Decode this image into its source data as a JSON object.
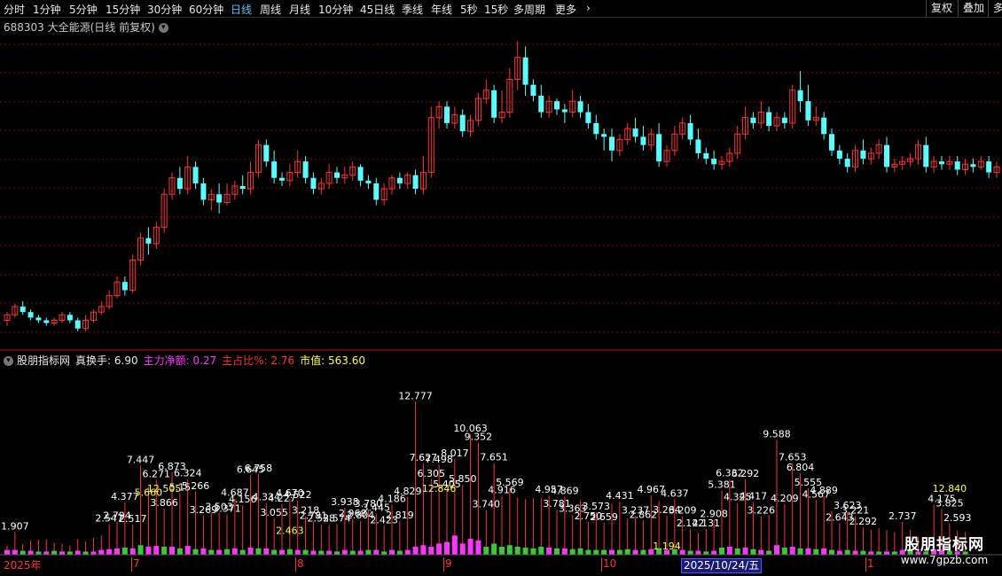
{
  "toolbar": {
    "timeframes": [
      "分时",
      "1分钟",
      "5分钟",
      "15分钟",
      "30分钟",
      "60分钟",
      "日线",
      "周线",
      "月线",
      "10分钟",
      "45日线",
      "季线",
      "年线",
      "5秒",
      "15秒",
      "多周期",
      "更多"
    ],
    "active_timeframe": "日线",
    "right_buttons": [
      "复权",
      "叠加",
      "多"
    ]
  },
  "stock": {
    "title": "688303 大全能源(日线 前复权)"
  },
  "indicator": {
    "name": "股朋指标网",
    "items": [
      {
        "label": "真换手: 6.90",
        "color": "#e8e8e8"
      },
      {
        "label": "主力净额: 0.27",
        "color": "#ff33ff"
      },
      {
        "label": "主占比%: 2.76",
        "color": "#ff3333"
      },
      {
        "label": "市值: 563.60",
        "color": "#ffff33"
      }
    ]
  },
  "axis": {
    "month_labels": [
      "2025年",
      "7",
      "8",
      "9",
      "10",
      "1"
    ],
    "cursor_date": "2025/10/24/五"
  },
  "watermark": {
    "title": "股朋指标网",
    "url": "www.7gpzb.com"
  },
  "colors": {
    "up": "#ff3333",
    "down": "#54ffff",
    "white_label": "#ffffff",
    "yellow_label": "#ffff33",
    "pos_bar": "#ff33ff",
    "neg_bar": "#33cc33",
    "stem": "#ff3333",
    "grid": "#8a0000"
  },
  "candles": [
    [
      46,
      48,
      44,
      49
    ],
    [
      48,
      51,
      47,
      52
    ],
    [
      51,
      49,
      48,
      53
    ],
    [
      49,
      47,
      46,
      50
    ],
    [
      47,
      46,
      45,
      48
    ],
    [
      46,
      45,
      44,
      47
    ],
    [
      45,
      46,
      44,
      47
    ],
    [
      46,
      48,
      45,
      49
    ],
    [
      48,
      46,
      45,
      49
    ],
    [
      46,
      43,
      42,
      47
    ],
    [
      43,
      46,
      42,
      48
    ],
    [
      46,
      49,
      45,
      50
    ],
    [
      49,
      51,
      48,
      53
    ],
    [
      51,
      55,
      50,
      57
    ],
    [
      55,
      60,
      54,
      62
    ],
    [
      60,
      57,
      55,
      62
    ],
    [
      57,
      68,
      56,
      70
    ],
    [
      68,
      76,
      66,
      78
    ],
    [
      76,
      74,
      70,
      80
    ],
    [
      74,
      80,
      72,
      82
    ],
    [
      80,
      92,
      78,
      94
    ],
    [
      92,
      98,
      90,
      100
    ],
    [
      98,
      94,
      92,
      102
    ],
    [
      94,
      102,
      92,
      106
    ],
    [
      102,
      96,
      94,
      104
    ],
    [
      96,
      90,
      88,
      98
    ],
    [
      90,
      92,
      86,
      94
    ],
    [
      92,
      89,
      85,
      96
    ],
    [
      89,
      92,
      88,
      96
    ],
    [
      92,
      95,
      90,
      97
    ],
    [
      95,
      94,
      92,
      99
    ],
    [
      94,
      100,
      92,
      104
    ],
    [
      100,
      110,
      98,
      112
    ],
    [
      110,
      104,
      102,
      112
    ],
    [
      104,
      98,
      96,
      108
    ],
    [
      98,
      97,
      95,
      100
    ],
    [
      97,
      100,
      95,
      103
    ],
    [
      100,
      104,
      98,
      108
    ],
    [
      104,
      98,
      96,
      106
    ],
    [
      98,
      94,
      92,
      100
    ],
    [
      94,
      96,
      92,
      98
    ],
    [
      96,
      100,
      94,
      103
    ],
    [
      100,
      98,
      96,
      102
    ],
    [
      98,
      99,
      96,
      102
    ],
    [
      99,
      102,
      97,
      104
    ],
    [
      102,
      97,
      95,
      103
    ],
    [
      97,
      96,
      94,
      99
    ],
    [
      96,
      90,
      88,
      98
    ],
    [
      90,
      94,
      88,
      96
    ],
    [
      94,
      98,
      92,
      99
    ],
    [
      98,
      96,
      94,
      100
    ],
    [
      96,
      99,
      94,
      100
    ],
    [
      99,
      94,
      92,
      101
    ],
    [
      94,
      100,
      92,
      106
    ],
    [
      100,
      120,
      98,
      124
    ],
    [
      120,
      124,
      116,
      126
    ],
    [
      124,
      118,
      116,
      126
    ],
    [
      118,
      121,
      116,
      124
    ],
    [
      121,
      115,
      113,
      123
    ],
    [
      115,
      119,
      113,
      121
    ],
    [
      119,
      127,
      117,
      129
    ],
    [
      127,
      130,
      125,
      134
    ],
    [
      130,
      120,
      118,
      132
    ],
    [
      120,
      122,
      118,
      130
    ],
    [
      122,
      134,
      120,
      138
    ],
    [
      134,
      142,
      130,
      148
    ],
    [
      142,
      132,
      128,
      146
    ],
    [
      132,
      128,
      126,
      134
    ],
    [
      128,
      122,
      120,
      132
    ],
    [
      122,
      126,
      120,
      128
    ],
    [
      126,
      123,
      121,
      127
    ],
    [
      123,
      122,
      118,
      125
    ],
    [
      122,
      126,
      120,
      130
    ],
    [
      126,
      122,
      120,
      128
    ],
    [
      122,
      118,
      116,
      125
    ],
    [
      118,
      114,
      112,
      121
    ],
    [
      114,
      113,
      108,
      116
    ],
    [
      113,
      108,
      104,
      116
    ],
    [
      108,
      112,
      106,
      114
    ],
    [
      112,
      116,
      110,
      118
    ],
    [
      116,
      113,
      111,
      120
    ],
    [
      113,
      110,
      108,
      117
    ],
    [
      110,
      114,
      108,
      116
    ],
    [
      114,
      104,
      102,
      118
    ],
    [
      104,
      108,
      102,
      110
    ],
    [
      108,
      114,
      106,
      117
    ],
    [
      114,
      118,
      112,
      120
    ],
    [
      118,
      112,
      110,
      121
    ],
    [
      112,
      107,
      105,
      116
    ],
    [
      107,
      105,
      103,
      109
    ],
    [
      105,
      103,
      101,
      108
    ],
    [
      103,
      104,
      101,
      106
    ],
    [
      104,
      107,
      102,
      109
    ],
    [
      107,
      114,
      105,
      117
    ],
    [
      114,
      120,
      112,
      124
    ],
    [
      120,
      118,
      116,
      122
    ],
    [
      118,
      122,
      116,
      126
    ],
    [
      122,
      117,
      115,
      124
    ],
    [
      117,
      120,
      115,
      122
    ],
    [
      120,
      118,
      116,
      122
    ],
    [
      118,
      130,
      116,
      132
    ],
    [
      130,
      126,
      122,
      137
    ],
    [
      126,
      119,
      117,
      132
    ],
    [
      119,
      120,
      117,
      124
    ],
    [
      120,
      114,
      112,
      122
    ],
    [
      114,
      108,
      106,
      116
    ],
    [
      108,
      105,
      103,
      110
    ],
    [
      105,
      102,
      100,
      107
    ],
    [
      102,
      108,
      100,
      110
    ],
    [
      108,
      105,
      103,
      112
    ],
    [
      105,
      107,
      103,
      109
    ],
    [
      107,
      110,
      105,
      112
    ],
    [
      110,
      102,
      100,
      113
    ],
    [
      102,
      103,
      100,
      105
    ],
    [
      103,
      104,
      101,
      106
    ],
    [
      104,
      105,
      102,
      107
    ],
    [
      105,
      110,
      103,
      112
    ],
    [
      110,
      102,
      100,
      113
    ],
    [
      102,
      104,
      100,
      106
    ],
    [
      104,
      103,
      101,
      106
    ],
    [
      103,
      104,
      101,
      106
    ],
    [
      104,
      101,
      99,
      106
    ],
    [
      101,
      103,
      99,
      105
    ],
    [
      103,
      102,
      100,
      105
    ],
    [
      102,
      104,
      101,
      106
    ],
    [
      104,
      100,
      98,
      106
    ],
    [
      100,
      102,
      98,
      104
    ]
  ],
  "volume_bars": [
    [
      0.8,
      0.3
    ],
    [
      1.907,
      0.3
    ],
    [
      0.9,
      -0.25
    ],
    [
      1.2,
      0.25
    ],
    [
      1.25,
      -0.2
    ],
    [
      1.247,
      0.2
    ],
    [
      1.0,
      -0.25
    ],
    [
      0.9,
      0.2
    ],
    [
      0.8,
      -0.2
    ],
    [
      1.3,
      0.25
    ],
    [
      1.1,
      -0.2
    ],
    [
      1.4,
      0.2
    ],
    [
      1.65,
      0.3
    ],
    [
      2.547,
      0.35
    ],
    [
      2.794,
      0.4
    ],
    [
      4.377,
      -0.45
    ],
    [
      2.517,
      0.4
    ],
    [
      7.447,
      -0.6
    ],
    [
      5.66,
      0.5
    ],
    [
      6.271,
      0.55
    ],
    [
      3.866,
      -0.5
    ],
    [
      6.873,
      0.5
    ],
    [
      5.15,
      -0.4
    ],
    [
      6.324,
      0.55
    ],
    [
      5.266,
      -0.35
    ],
    [
      3.269,
      0.4
    ],
    [
      3.511,
      -0.3
    ],
    [
      3.503,
      0.3
    ],
    [
      3.371,
      -0.35
    ],
    [
      4.687,
      0.4
    ],
    [
      4.156,
      -0.3
    ],
    [
      6.645,
      0.45
    ],
    [
      6.758,
      -0.4
    ],
    [
      4.334,
      0.4
    ],
    [
      3.055,
      -0.3
    ],
    [
      4.227,
      0.3
    ],
    [
      4.67,
      -0.35
    ],
    [
      4.522,
      0.3
    ],
    [
      3.218,
      -0.3
    ],
    [
      2.781,
      0.25
    ],
    [
      2.538,
      -0.25
    ],
    [
      2.454,
      0.25
    ],
    [
      2.574,
      -0.2
    ],
    [
      3.938,
      0.3
    ],
    [
      2.968,
      -0.25
    ],
    [
      2.804,
      0.25
    ],
    [
      3.78,
      -0.3
    ],
    [
      3.445,
      0.3
    ],
    [
      2.423,
      -0.2
    ],
    [
      4.186,
      0.3
    ],
    [
      2.819,
      -0.25
    ],
    [
      4.829,
      0.3
    ],
    [
      12.777,
      0.5
    ],
    [
      7.627,
      0.6
    ],
    [
      6.305,
      0.5
    ],
    [
      7.498,
      0.7
    ],
    [
      5.405,
      0.8
    ],
    [
      8.017,
      1.2
    ],
    [
      5.85,
      0.7
    ],
    [
      10.063,
      1.0
    ],
    [
      9.352,
      0.9
    ],
    [
      3.74,
      -0.5
    ],
    [
      7.651,
      -0.7
    ],
    [
      4.916,
      -0.5
    ],
    [
      5.569,
      -0.6
    ],
    [
      4.78,
      -0.5
    ],
    [
      4.649,
      -0.45
    ],
    [
      4.752,
      -0.4
    ],
    [
      4.781,
      -0.5
    ],
    [
      4.957,
      0.45
    ],
    [
      3.781,
      -0.4
    ],
    [
      4.869,
      0.4
    ],
    [
      3.363,
      -0.35
    ],
    [
      4.564,
      -0.4
    ],
    [
      2.75,
      -0.3
    ],
    [
      3.573,
      -0.3
    ],
    [
      2.659,
      -0.3
    ],
    [
      4.264,
      0.3
    ],
    [
      4.431,
      -0.3
    ],
    [
      3.033,
      -0.35
    ],
    [
      3.237,
      0.3
    ],
    [
      2.862,
      -0.3
    ],
    [
      4.967,
      0.35
    ],
    [
      4.498,
      -0.4
    ],
    [
      3.264,
      0.3
    ],
    [
      4.637,
      -0.35
    ],
    [
      3.209,
      0.3
    ],
    [
      2.142,
      -0.25
    ],
    [
      1.831,
      0.25
    ],
    [
      2.131,
      -0.2
    ],
    [
      2.908,
      0.25
    ],
    [
      5.381,
      -0.45
    ],
    [
      6.332,
      0.5
    ],
    [
      4.325,
      -0.4
    ],
    [
      6.292,
      0.45
    ],
    [
      4.417,
      -0.35
    ],
    [
      3.226,
      0.3
    ],
    [
      3.306,
      -0.25
    ],
    [
      9.588,
      0.6
    ],
    [
      4.209,
      -0.45
    ],
    [
      7.653,
      0.5
    ],
    [
      6.804,
      -0.4
    ],
    [
      5.555,
      0.4
    ],
    [
      4.567,
      -0.35
    ],
    [
      4.889,
      0.4
    ],
    [
      3.63,
      -0.3
    ],
    [
      2.643,
      0.25
    ],
    [
      3.623,
      -0.3
    ],
    [
      3.221,
      0.25
    ],
    [
      2.292,
      -0.25
    ],
    [
      2.083,
      0.2
    ],
    [
      2.222,
      -0.2
    ],
    [
      2.063,
      0.2
    ],
    [
      1.9,
      -0.2
    ],
    [
      2.737,
      0.3
    ],
    [
      2.067,
      -0.25
    ],
    [
      1.5,
      0.2
    ],
    [
      1.3,
      -0.2
    ],
    [
      4.175,
      0.35
    ],
    [
      3.825,
      0.3
    ],
    [
      2.593,
      -0.25
    ],
    [
      2.013,
      0.2
    ],
    [
      1.9,
      -0.2
    ]
  ],
  "volume_labels": [
    {
      "i": 1,
      "t": "1.907",
      "c": "w"
    },
    {
      "i": 13,
      "t": "2.547",
      "c": "w"
    },
    {
      "i": 14,
      "t": "2.794",
      "c": "w"
    },
    {
      "i": 15,
      "t": "4.377",
      "c": "w"
    },
    {
      "i": 16,
      "t": "2.517",
      "c": "w"
    },
    {
      "i": 17,
      "t": "7.447",
      "c": "w"
    },
    {
      "i": 18,
      "t": "5.660",
      "c": "y"
    },
    {
      "i": 19,
      "t": "6.271",
      "c": "w"
    },
    {
      "i": 20,
      "t": "3.866",
      "c": "w"
    },
    {
      "i": 21,
      "t": "6.873",
      "c": "w"
    },
    {
      "i": 22,
      "t": "5.15",
      "c": "w"
    },
    {
      "i": 23,
      "t": "6.324",
      "c": "w"
    },
    {
      "i": 24,
      "t": "5.266",
      "c": "w"
    },
    {
      "i": 25,
      "t": "3.269",
      "c": "w"
    },
    {
      "i": 27,
      "t": "3.503",
      "c": "w"
    },
    {
      "i": 28,
      "t": "3.371",
      "c": "w"
    },
    {
      "i": 29,
      "t": "4.687",
      "c": "w"
    },
    {
      "i": 30,
      "t": "4.156",
      "c": "w"
    },
    {
      "i": 31,
      "t": "6.645",
      "c": "w"
    },
    {
      "i": 32,
      "t": "6.758",
      "c": "w"
    },
    {
      "i": 33,
      "t": "4.334",
      "c": "w"
    },
    {
      "i": 34,
      "t": "3.055",
      "c": "w"
    },
    {
      "i": 35,
      "t": "4.227",
      "c": "w"
    },
    {
      "i": 36,
      "t": "4.670",
      "c": "w"
    },
    {
      "i": 37,
      "t": "4.522",
      "c": "w"
    },
    {
      "i": 38,
      "t": "3.218",
      "c": "w"
    },
    {
      "i": 39,
      "t": "2.781",
      "c": "w"
    },
    {
      "i": 40,
      "t": "2.538",
      "c": "w"
    },
    {
      "i": 42,
      "t": "2.574",
      "c": "w"
    },
    {
      "i": 43,
      "t": "3.938",
      "c": "w"
    },
    {
      "i": 44,
      "t": "2.968",
      "c": "w"
    },
    {
      "i": 45,
      "t": "2.804",
      "c": "w"
    },
    {
      "i": 46,
      "t": "3.780",
      "c": "w"
    },
    {
      "i": 47,
      "t": "3.445",
      "c": "w"
    },
    {
      "i": 48,
      "t": "2.423",
      "c": "w"
    },
    {
      "i": 49,
      "t": "4.186",
      "c": "w"
    },
    {
      "i": 50,
      "t": "2.819",
      "c": "w"
    },
    {
      "i": 51,
      "t": "4.829",
      "c": "w"
    },
    {
      "i": 52,
      "t": "12.777",
      "c": "w"
    },
    {
      "i": 53,
      "t": "7.627",
      "c": "w"
    },
    {
      "i": 54,
      "t": "6.305",
      "c": "w"
    },
    {
      "i": 55,
      "t": "7.498",
      "c": "w"
    },
    {
      "i": 56,
      "t": "5.405",
      "c": "w"
    },
    {
      "i": 57,
      "t": "8.017",
      "c": "w"
    },
    {
      "i": 58,
      "t": "5.850",
      "c": "w"
    },
    {
      "i": 59,
      "t": "10.063",
      "c": "w"
    },
    {
      "i": 60,
      "t": "9.352",
      "c": "w"
    },
    {
      "i": 61,
      "t": "3.740",
      "c": "w"
    },
    {
      "i": 62,
      "t": "7.651",
      "c": "w"
    },
    {
      "i": 63,
      "t": "4.916",
      "c": "w"
    },
    {
      "i": 64,
      "t": "5.569",
      "c": "w"
    },
    {
      "i": 69,
      "t": "4.957",
      "c": "w"
    },
    {
      "i": 70,
      "t": "3.781",
      "c": "w"
    },
    {
      "i": 71,
      "t": "4.869",
      "c": "w"
    },
    {
      "i": 72,
      "t": "3.363",
      "c": "w"
    },
    {
      "i": 74,
      "t": "2.750",
      "c": "w"
    },
    {
      "i": 75,
      "t": "3.573",
      "c": "w"
    },
    {
      "i": 76,
      "t": "2.659",
      "c": "w"
    },
    {
      "i": 78,
      "t": "4.431",
      "c": "w"
    },
    {
      "i": 80,
      "t": "3.237",
      "c": "w"
    },
    {
      "i": 81,
      "t": "2.862",
      "c": "w"
    },
    {
      "i": 82,
      "t": "4.967",
      "c": "w"
    },
    {
      "i": 84,
      "t": "3.264",
      "c": "w"
    },
    {
      "i": 85,
      "t": "4.637",
      "c": "w"
    },
    {
      "i": 86,
      "t": "3.209",
      "c": "w"
    },
    {
      "i": 87,
      "t": "2.142",
      "c": "w"
    },
    {
      "i": 89,
      "t": "2.131",
      "c": "w"
    },
    {
      "i": 90,
      "t": "2.908",
      "c": "w"
    },
    {
      "i": 91,
      "t": "5.381",
      "c": "w"
    },
    {
      "i": 92,
      "t": "6.332",
      "c": "w"
    },
    {
      "i": 93,
      "t": "4.325",
      "c": "w"
    },
    {
      "i": 94,
      "t": "6.292",
      "c": "w"
    },
    {
      "i": 95,
      "t": "4.417",
      "c": "w"
    },
    {
      "i": 96,
      "t": "3.226",
      "c": "w"
    },
    {
      "i": 98,
      "t": "9.588",
      "c": "w"
    },
    {
      "i": 99,
      "t": "4.209",
      "c": "w"
    },
    {
      "i": 100,
      "t": "7.653",
      "c": "w"
    },
    {
      "i": 101,
      "t": "6.804",
      "c": "w"
    },
    {
      "i": 102,
      "t": "5.555",
      "c": "w"
    },
    {
      "i": 103,
      "t": "4.567",
      "c": "w"
    },
    {
      "i": 104,
      "t": "4.889",
      "c": "w"
    },
    {
      "i": 106,
      "t": "2.643",
      "c": "w"
    },
    {
      "i": 107,
      "t": "3.623",
      "c": "w"
    },
    {
      "i": 108,
      "t": "3.221",
      "c": "w"
    },
    {
      "i": 109,
      "t": "2.292",
      "c": "w"
    },
    {
      "i": 114,
      "t": "2.737",
      "c": "w"
    },
    {
      "i": 119,
      "t": "4.175",
      "c": "w"
    },
    {
      "i": 120,
      "t": "3.825",
      "c": "w"
    },
    {
      "i": 121,
      "t": "2.593",
      "c": "w"
    },
    {
      "i": 20,
      "t": "12.505",
      "c": "y"
    },
    {
      "i": 36,
      "t": "2.463",
      "c": "y"
    },
    {
      "i": 55,
      "t": "12.846",
      "c": "y"
    },
    {
      "i": 84,
      "t": "1.194",
      "c": "y"
    },
    {
      "i": 120,
      "t": "12.840",
      "c": "y"
    }
  ]
}
